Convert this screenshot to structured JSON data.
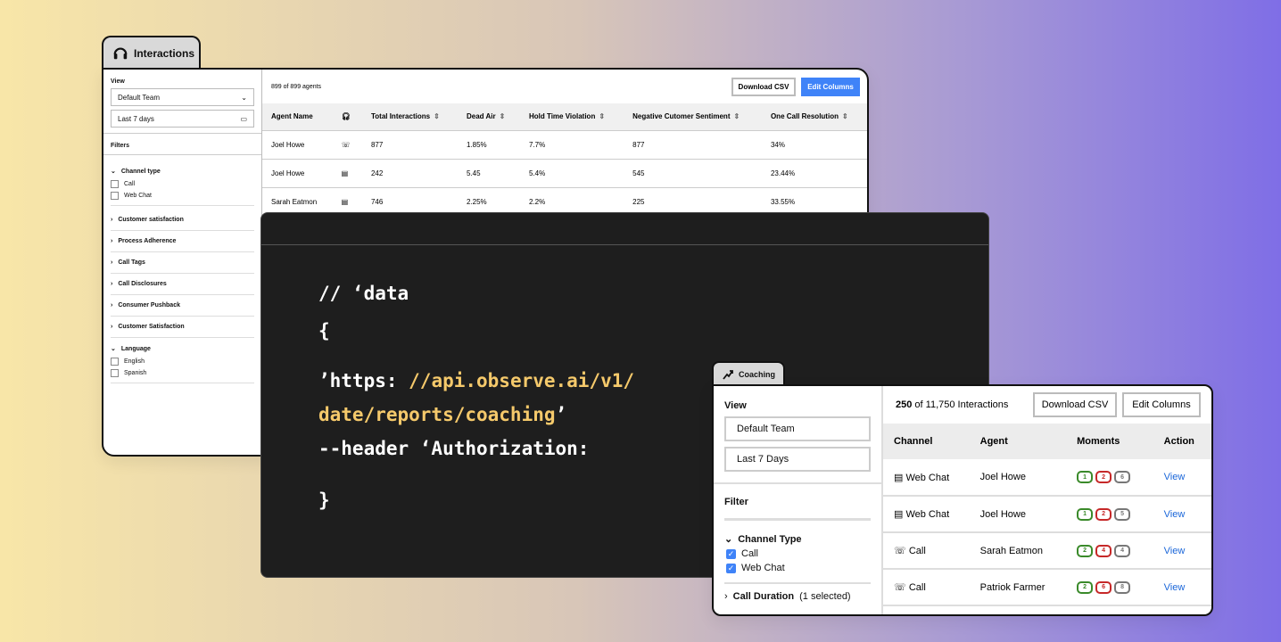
{
  "interactions": {
    "tab_title": "Interactions",
    "view_label": "View",
    "team_select": "Default Team",
    "date_select": "Last 7 days",
    "filters_label": "Filters",
    "channel_type_label": "Channel type",
    "channel_options": [
      "Call",
      "Web Chat"
    ],
    "filter_groups": [
      "Customer satisfaction",
      "Process Adherence",
      "Call Tags",
      "Call Disclosures",
      "Consumer Pushback",
      "Customer Satisfaction"
    ],
    "language_label": "Language",
    "language_options": [
      "English",
      "Spanish"
    ],
    "agent_count": "899 of 899 agents",
    "download_csv": "Download CSV",
    "edit_columns": "Edit Columns",
    "columns": [
      "Agent Name",
      "Total Interactions",
      "Dead Air",
      "Hold Time Violation",
      "Negative Cutomer Sentiment",
      "One Call Resolution"
    ],
    "rows": [
      {
        "agent": "Joel Howe",
        "channel": "phone-icon",
        "total": "877",
        "dead_air": "1.85%",
        "hold": "7.7%",
        "negative": "877",
        "resolution": "34%"
      },
      {
        "agent": "Joel Howe",
        "channel": "chat-icon",
        "total": "242",
        "dead_air": "5.45",
        "hold": "5.4%",
        "negative": "545",
        "resolution": "23.44%"
      },
      {
        "agent": "Sarah Eatmon",
        "channel": "chat-icon",
        "total": "746",
        "dead_air": "2.25%",
        "hold": "2.2%",
        "negative": "225",
        "resolution": "33.55%"
      }
    ]
  },
  "code": {
    "line1": "// ‘data",
    "line2": "{",
    "line3_prefix": "’https: ",
    "line3_url": "//api.observe.ai/v1/",
    "line4_url": "date/reports/coaching",
    "line4_suffix": "’",
    "line5": "--header ‘Authorization:",
    "line6": "}"
  },
  "coaching": {
    "tab_title": "Coaching",
    "view_label": "View",
    "team_input": "Default Team",
    "date_input": "Last 7 Days",
    "filter_label": "Filter",
    "channel_type_label": "Channel Type",
    "channel_options": [
      "Call",
      "Web Chat"
    ],
    "call_duration_label": "Call Duration",
    "call_duration_note": "(1 selected)",
    "count_bold": "250",
    "count_rest": " of 11,750 Interactions",
    "download_csv": "Download CSV",
    "edit_columns": "Edit Columns",
    "columns": [
      "Channel",
      "Agent",
      "Moments",
      "Action"
    ],
    "rows": [
      {
        "channel": "Web Chat",
        "icon": "chat-icon",
        "agent": "Joel Howe",
        "m": [
          "1",
          "2",
          "6"
        ],
        "action": "View"
      },
      {
        "channel": "Web Chat",
        "icon": "chat-icon",
        "agent": "Joel Howe",
        "m": [
          "1",
          "2",
          "5"
        ],
        "action": "View"
      },
      {
        "channel": "Call",
        "icon": "phone-icon",
        "agent": "Sarah Eatmon",
        "m": [
          "2",
          "4",
          "4"
        ],
        "action": "View"
      },
      {
        "channel": "Call",
        "icon": "phone-icon",
        "agent": "Patriok Farmer",
        "m": [
          "2",
          "6",
          "8"
        ],
        "action": "View"
      }
    ]
  },
  "colors": {
    "accent_blue": "#3f83f8",
    "code_yellow": "#f5c96b",
    "code_bg": "#1e1e1e"
  }
}
